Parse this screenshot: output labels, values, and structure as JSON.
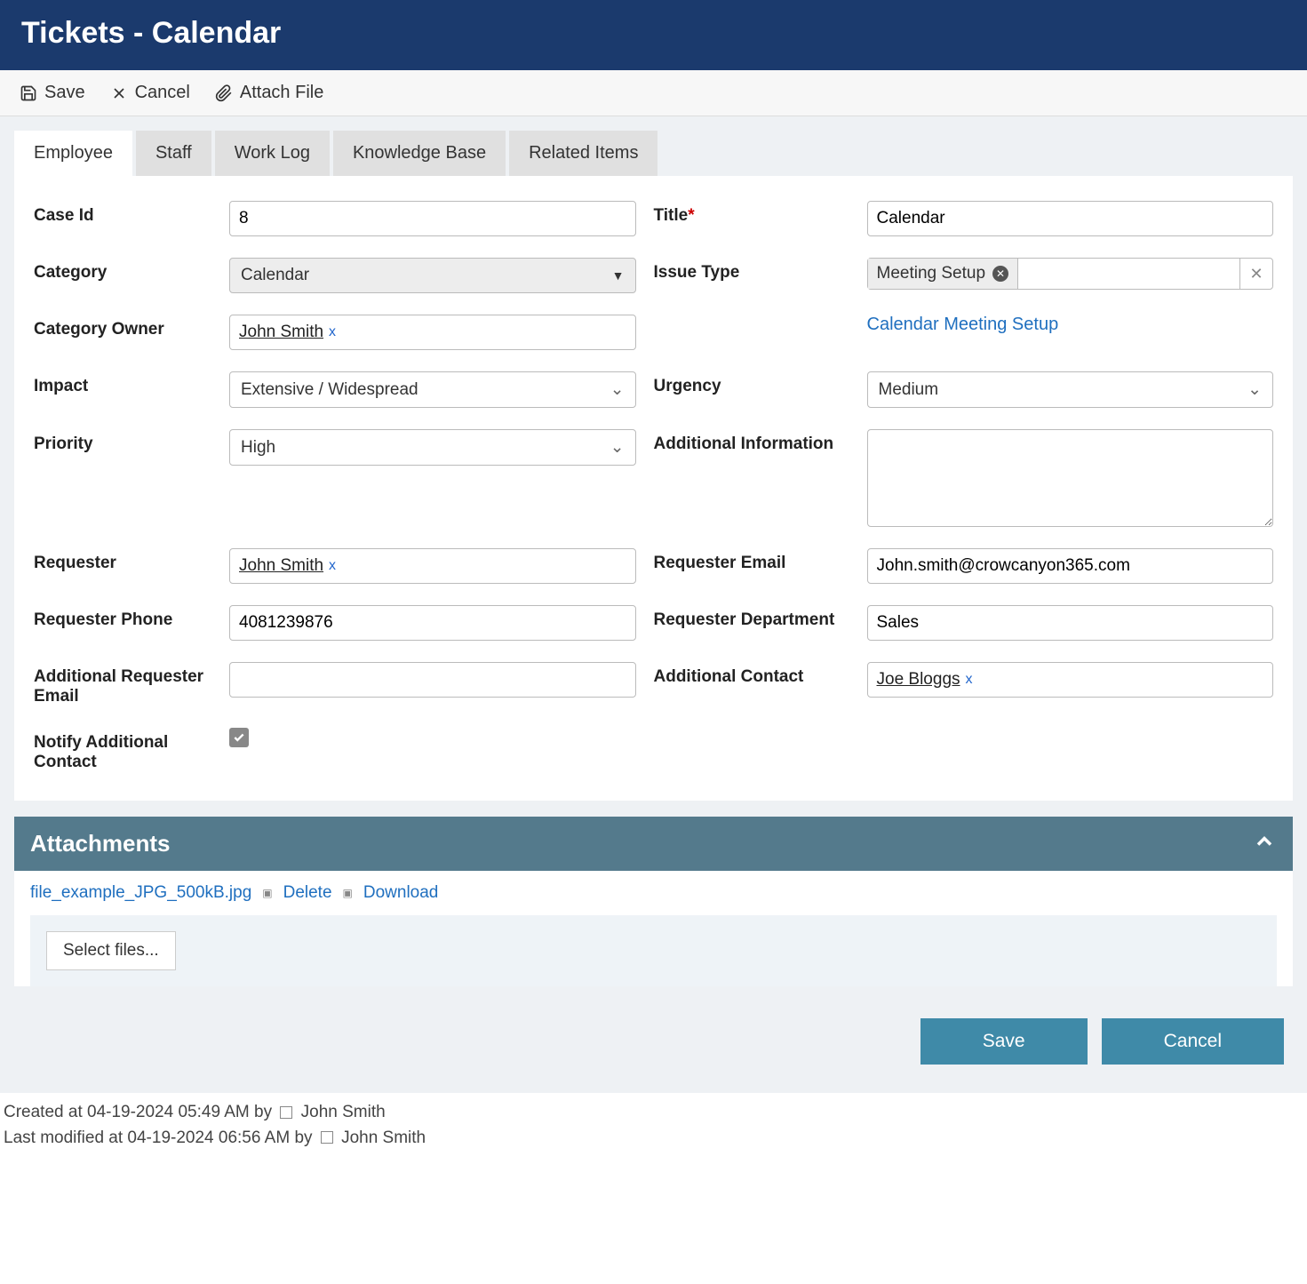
{
  "header": {
    "title": "Tickets - Calendar"
  },
  "toolbar": {
    "save": "Save",
    "cancel": "Cancel",
    "attach": "Attach File"
  },
  "tabs": {
    "employee": "Employee",
    "staff": "Staff",
    "worklog": "Work Log",
    "kb": "Knowledge Base",
    "related": "Related Items"
  },
  "labels": {
    "case_id": "Case Id",
    "title": "Title",
    "category": "Category",
    "issue_type": "Issue Type",
    "category_owner": "Category Owner",
    "kb_link": "Calendar Meeting Setup",
    "impact": "Impact",
    "urgency": "Urgency",
    "priority": "Priority",
    "additional_info": "Additional Information",
    "requester": "Requester",
    "requester_email": "Requester Email",
    "requester_phone": "Requester Phone",
    "requester_dept": "Requester Department",
    "additional_req_email": "Additional Requester Email",
    "additional_contact": "Additional Contact",
    "notify_additional": "Notify Additional Contact"
  },
  "values": {
    "case_id": "8",
    "title": "Calendar",
    "category": "Calendar",
    "issue_type": "Meeting Setup",
    "category_owner": "John Smith",
    "impact": "Extensive / Widespread",
    "urgency": "Medium",
    "priority": "High",
    "additional_info": "",
    "requester": "John Smith",
    "requester_email": "John.smith@crowcanyon365.com",
    "requester_phone": "4081239876",
    "requester_dept": "Sales",
    "additional_req_email": "",
    "additional_contact": "Joe Bloggs",
    "notify_additional": true
  },
  "attachments": {
    "header": "Attachments",
    "file": "file_example_JPG_500kB.jpg",
    "delete": "Delete",
    "download": "Download",
    "select_files": "Select files..."
  },
  "actions": {
    "save": "Save",
    "cancel": "Cancel"
  },
  "meta": {
    "created_prefix": "Created at ",
    "created_time": "04-19-2024 05:49 AM",
    "by": " by ",
    "created_user": "John Smith",
    "modified_prefix": "Last modified at ",
    "modified_time": "04-19-2024 06:56 AM",
    "modified_user": "John Smith"
  }
}
